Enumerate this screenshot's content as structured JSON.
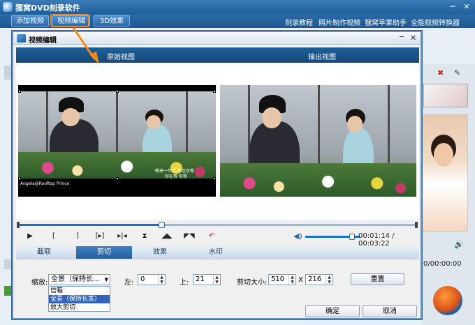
{
  "app": {
    "title": "狸窝DVD刻录软件"
  },
  "window_controls": {
    "minimize": "─",
    "close": "✕"
  },
  "toolbar": {
    "add_video": "添加视频",
    "edit_video": "视频编辑",
    "effect_3d": "3D效果",
    "links": [
      "刻录教程",
      "照片制作视频",
      "狸窝苹果助手",
      "全能视频转换器"
    ]
  },
  "dialog": {
    "title": "视频编辑",
    "minimize": "─",
    "close": "✕",
    "original_view": "原始视图",
    "output_view": "输出视图",
    "watermark": "Angela@Rooftop Prince",
    "subtitle_line1": "晚来一年半 你也在等",
    "subtitle_line2": "你在等 你等",
    "time": "00:01:14 / 00:03:22",
    "progress_fraction": 0.36,
    "volume_fraction": 0.86,
    "tabs": [
      "截取",
      "剪切",
      "效果",
      "水印"
    ],
    "active_tab": 1,
    "zoom_label": "缩放:",
    "zoom_value": "全景（保持长…",
    "zoom_options": [
      "信箱",
      "全景（保持长宽）",
      "放大剪切"
    ],
    "zoom_selected": 1,
    "left_label": "左:",
    "left_value": "0",
    "top_label": "上:",
    "top_value": "21",
    "crop_size_label": "剪切大小:",
    "crop_width": "510",
    "crop_x": "X",
    "crop_height": "216",
    "reset": "重置",
    "ok": "确定",
    "cancel": "取消"
  },
  "background_app": {
    "time_display": "0/00:00:00"
  },
  "icons": {
    "play": "play-icon",
    "mark_in": "mark-in-icon",
    "mark_out": "mark-out-icon",
    "next_frame": "next-frame-icon",
    "skip_end": "skip-end-icon",
    "split": "split-icon",
    "cut_left": "cut-left-icon",
    "cut_right": "cut-right-icon",
    "undo": "undo-icon",
    "volume": "volume-icon"
  },
  "colors": {
    "accent": "#2a6aa6",
    "callout": "#f08a1c",
    "selection": "#3264b8"
  }
}
